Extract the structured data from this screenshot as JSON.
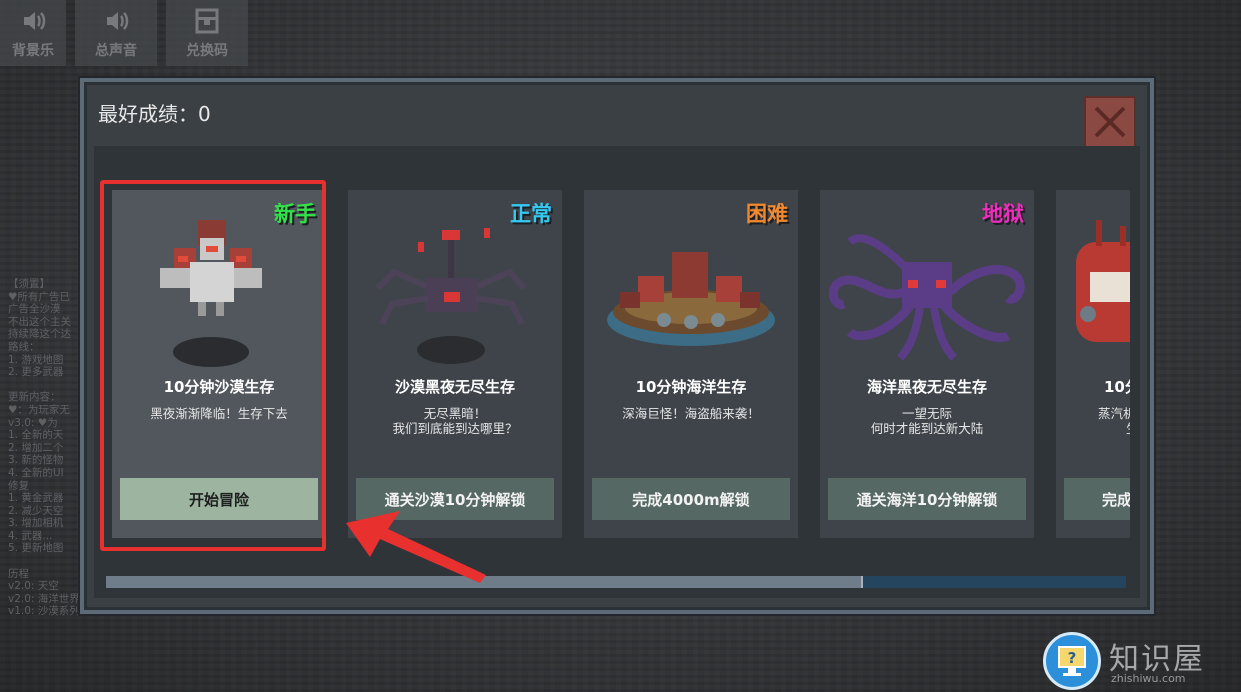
{
  "toolbar": {
    "items": [
      {
        "label": "背景乐",
        "icon": "speaker-icon"
      },
      {
        "label": "总声音",
        "icon": "speaker-icon"
      },
      {
        "label": "兑换码",
        "icon": "gift-box-icon"
      }
    ]
  },
  "changelog": {
    "text": "【须置】\n♥所有广告已\n广告全沙漠\n不出这个主关\n持续降这个达\n路线：\n1. 游戏地图\n2. 更多武器\n\n更新内容：\n♥：为玩家无\nv3.0: ♥为\n1. 全新的天\n2. 增加二个\n3. 新的怪物\n4. 全新的UI\n修复\n1. 黄金武器\n2. 减少天空\n3. 增加相机\n4. 武器...\n5. 更新地图\n\n历程\nv2.0: 天空\nv2.0: 海洋世界大章追版的\nv1.0: 沙漠系列关卡"
  },
  "dialog": {
    "best_score_label": "最好成绩：",
    "best_score_value": "0",
    "colors": {
      "easy": "#33e24a",
      "normal": "#36c9f2",
      "hard": "#f2892f",
      "hell": "#f02bbd"
    },
    "levels": [
      {
        "difficulty": "新手",
        "title": "10分钟沙漠生存",
        "desc_line1": "黑夜渐渐降临！生存下去",
        "desc_line2": "",
        "button": "开始冒险",
        "icon": "three-headed-bird-boss-icon"
      },
      {
        "difficulty": "正常",
        "title": "沙漠黑夜无尽生存",
        "desc_line1": "无尽黑暗！",
        "desc_line2": "我们到底能到达哪里？",
        "button": "通关沙漠10分钟解锁",
        "icon": "shadow-spider-boss-icon"
      },
      {
        "difficulty": "困难",
        "title": "10分钟海洋生存",
        "desc_line1": "深海巨怪！海盗船来袭！",
        "desc_line2": "",
        "button": "完成4000m解锁",
        "icon": "pirate-ship-icon"
      },
      {
        "difficulty": "地狱",
        "title": "海洋黑夜无尽生存",
        "desc_line1": "一望无际",
        "desc_line2": "何时才能到达新大陆",
        "button": "通关海洋10分钟解锁",
        "icon": "kraken-octopus-icon"
      },
      {
        "difficulty": "",
        "title": "10分",
        "desc_line1": "蒸汽机",
        "desc_line2": "生",
        "button": "完成5",
        "icon": "steam-machine-icon"
      }
    ],
    "scroll_fraction": 0.74
  },
  "watermark": {
    "text": "知识屋",
    "sub": "zhishiwu.com"
  }
}
